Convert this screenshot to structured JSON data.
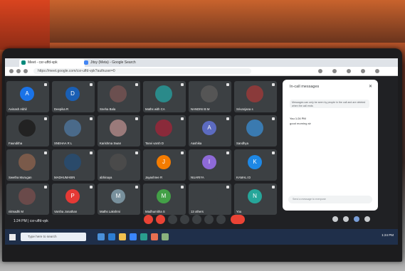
{
  "browser": {
    "tabs": [
      "Meet - csr-uffd-vpk",
      "Jitsy (Meta) - Google Search"
    ],
    "url": "https://meet.google.com/csr-uffd-vpk?authuser=0"
  },
  "participants": [
    {
      "name": "Avinash Akhil",
      "initial": "A",
      "color": "#1a73e8"
    },
    {
      "name": "Deepika R",
      "initial": "D",
      "color": "#1a5fb4"
    },
    {
      "name": "Sneha Bala",
      "initial": "",
      "color": "#6b4f4f"
    },
    {
      "name": "Maths with CA",
      "initial": "",
      "color": "#2a8a8a"
    },
    {
      "name": "NANDINI B M",
      "initial": "",
      "color": "#555"
    },
    {
      "name": "Srivanjana s",
      "initial": "",
      "color": "#8a3a3a"
    },
    {
      "name": "Faunditha",
      "initial": "",
      "color": "#222"
    },
    {
      "name": "SNEHAA R L",
      "initial": "",
      "color": "#4a6a8a"
    },
    {
      "name": "Karishma Swan",
      "initial": "",
      "color": "#9a7a7a"
    },
    {
      "name": "Tanvi varsh D",
      "initial": "",
      "color": "#8a2a3a"
    },
    {
      "name": "Aashika",
      "initial": "A",
      "color": "#5c6bc0"
    },
    {
      "name": "Sandhya",
      "initial": "",
      "color": "#3a7ab0"
    },
    {
      "name": "Swetha Murugan",
      "initial": "",
      "color": "#7a5a4a"
    },
    {
      "name": "MADHUMABIN",
      "initial": "",
      "color": "#2a4a6a"
    },
    {
      "name": "abhinaya",
      "initial": "",
      "color": "#4a4a4a"
    },
    {
      "name": "Jayashree R",
      "initial": "J",
      "color": "#f57c00"
    },
    {
      "name": "NUARIYA",
      "initial": "I",
      "color": "#8e6ad8"
    },
    {
      "name": "KAMALI D",
      "initial": "K",
      "color": "#1e88e5"
    },
    {
      "name": "nitmadhi M",
      "initial": "",
      "color": "#6a4a4a"
    },
    {
      "name": "Varsha Jonathan",
      "initial": "P",
      "color": "#e53935"
    },
    {
      "name": "Maths Lakshmi",
      "initial": "M",
      "color": "#78909c"
    },
    {
      "name": "Madhumitha S",
      "initial": "M",
      "color": "#43a047"
    },
    {
      "name": "13 others",
      "initial": "",
      "color": "#3c4043"
    },
    {
      "name": "You",
      "initial": "N",
      "color": "#26a69a"
    }
  ],
  "chat": {
    "title": "In-call messages",
    "note": "Messages can only be seen by people in the call and are deleted when the call ends",
    "messages": [
      {
        "sender": "You  1:24 PM",
        "text": "good morning sir"
      }
    ],
    "input_placeholder": "Send a message to everyone"
  },
  "meeting": {
    "code": "1:24 PM  |  csr-uffd-vpk"
  },
  "taskbar": {
    "search_placeholder": "Type here to search",
    "clock": "1:24 PM"
  }
}
